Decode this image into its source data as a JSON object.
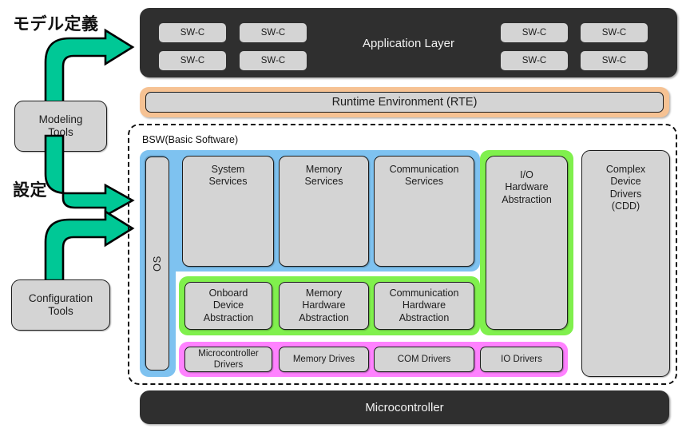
{
  "left_column": {
    "label_top": "モデル定義",
    "label_mid": "設定",
    "modeling_tools": "Modeling\nTools",
    "modeling_tools_line1": "Modeling",
    "modeling_tools_line2": "Tools",
    "configuration_tools_line1": "Configuration",
    "configuration_tools_line2": "Tools",
    "arrow_color": "#00C896"
  },
  "application_layer": {
    "title": "Application Layer",
    "swc_label": "SW-C",
    "swc_count": 8,
    "bg_color": "#2F2F2F",
    "swc_color": "#D4D4D4"
  },
  "rte": {
    "title": "Runtime Environment (RTE)",
    "border_color": "#F6C293",
    "fill_color": "#D4D4D4"
  },
  "bsw": {
    "label": "BSW(Basic Software)",
    "os_label": "OS",
    "panel_colors": {
      "services": "#7EC2F0",
      "abstraction": "#80F04D",
      "drivers": "#FF82FF"
    },
    "services": [
      {
        "line1": "System",
        "line2": "Services"
      },
      {
        "line1": "Memory",
        "line2": "Services"
      },
      {
        "line1": "Communication",
        "line2": "Services"
      }
    ],
    "abstraction": [
      {
        "line1": "Onboard",
        "line2": "Device",
        "line3": "Abstraction"
      },
      {
        "line1": "Memory",
        "line2": "Hardware",
        "line3": "Abstraction"
      },
      {
        "line1": "Communication",
        "line2": "Hardware",
        "line3": "Abstraction"
      }
    ],
    "drivers": [
      {
        "line1": "Microcontroller",
        "line2": "Drivers"
      },
      {
        "line1": "Memory Drives",
        "line2": ""
      },
      {
        "line1": "COM Drivers",
        "line2": ""
      },
      {
        "line1": "IO Drivers",
        "line2": ""
      }
    ],
    "io_hardware_abstraction": {
      "line1": "I/O",
      "line2": "Hardware",
      "line3": "Abstraction"
    },
    "io_drivers": "IO Drivers",
    "complex_device_drivers": {
      "line1": "Complex",
      "line2": "Device",
      "line3": "Drivers",
      "line4": "(CDD)"
    }
  },
  "microcontroller": {
    "title": "Microcontroller",
    "bg_color": "#2F2F2F"
  }
}
